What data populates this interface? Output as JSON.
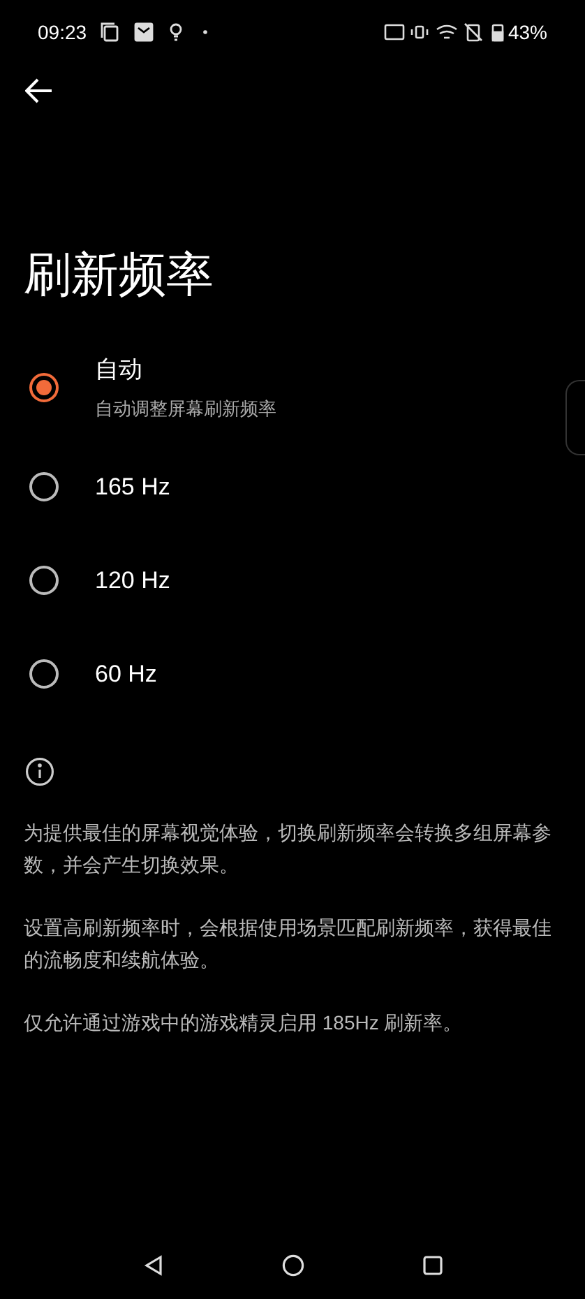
{
  "status_bar": {
    "time": "09:23",
    "battery": "43%"
  },
  "title": "刷新频率",
  "options": [
    {
      "label": "自动",
      "description": "自动调整屏幕刷新频率",
      "selected": true
    },
    {
      "label": "165 Hz",
      "selected": false
    },
    {
      "label": "120 Hz",
      "selected": false
    },
    {
      "label": "60 Hz",
      "selected": false
    }
  ],
  "notes": [
    "为提供最佳的屏幕视觉体验，切换刷新频率会转换多组屏幕参数，并会产生切换效果。",
    "设置高刷新频率时，会根据使用场景匹配刷新频率，获得最佳的流畅度和续航体验。",
    "仅允许通过游戏中的游戏精灵启用 185Hz 刷新率。"
  ]
}
